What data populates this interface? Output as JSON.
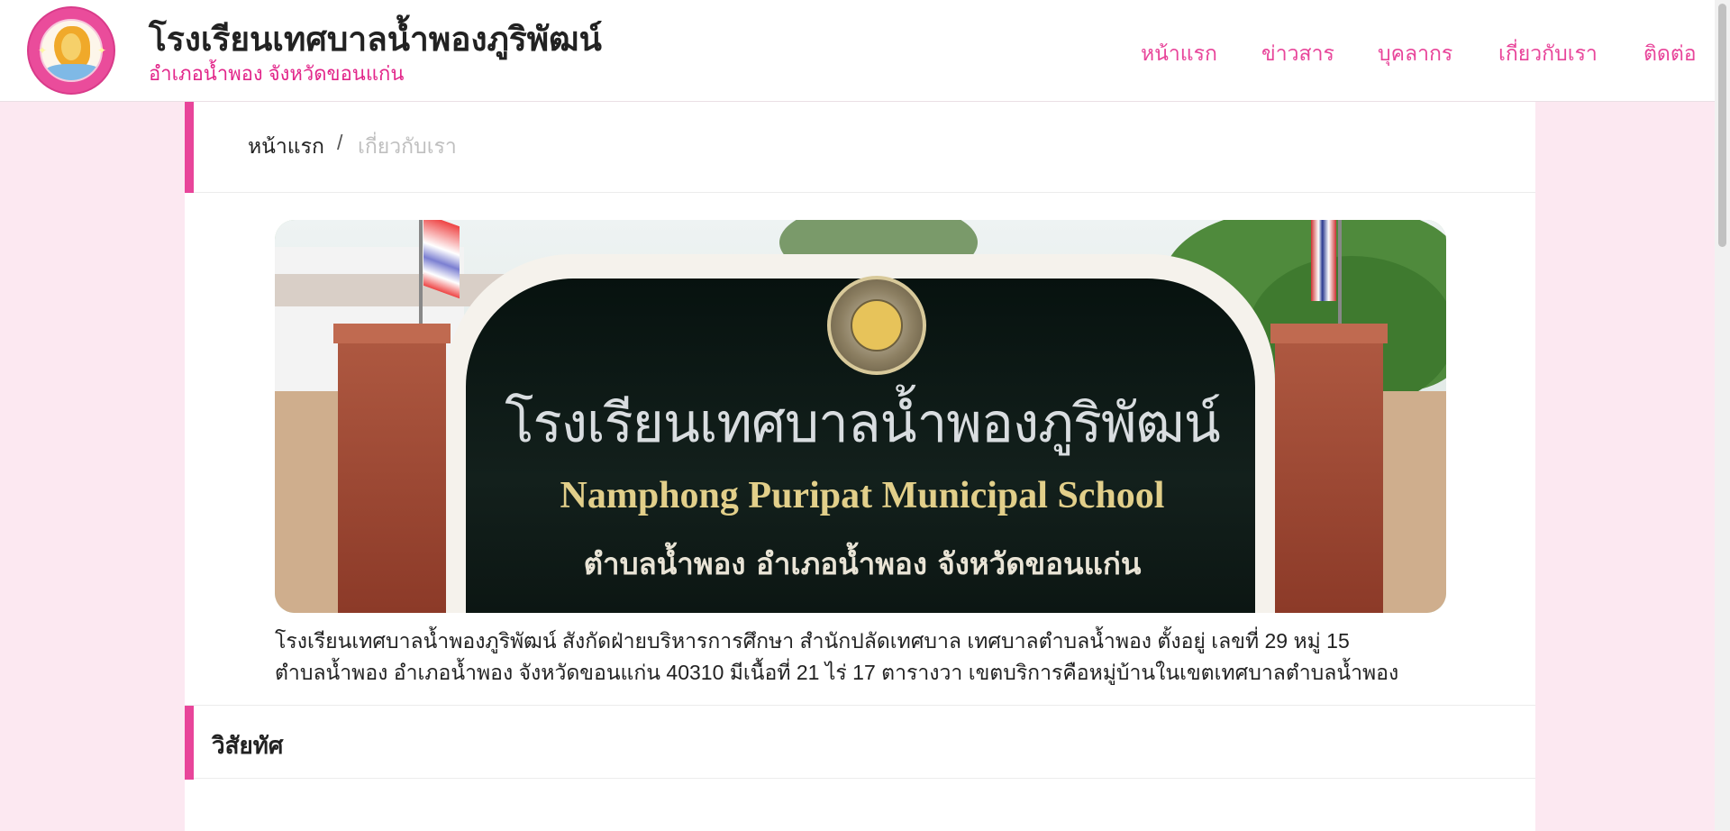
{
  "header": {
    "title": "โรงเรียนเทศบาลน้ำพองภูริพัฒน์",
    "subtitle": "อำเภอน้ำพอง จังหวัดขอนแก่น",
    "nav": [
      {
        "label": "หน้าแรก"
      },
      {
        "label": "ข่าวสาร"
      },
      {
        "label": "บุคลากร"
      },
      {
        "label": "เกี่ยวกับเรา"
      },
      {
        "label": "ติดต่อ"
      }
    ]
  },
  "breadcrumb": {
    "home": "หน้าแรก",
    "separator": "/",
    "current": "เกี่ยวกับเรา"
  },
  "photo": {
    "sign_thai": "โรงเรียนเทศบาลน้ำพองภูริพัฒน์",
    "sign_english": "Namphong Puripat Municipal School",
    "sign_address": "ตำบลน้ำพอง อำเภอน้ำพอง จังหวัดขอนแก่น"
  },
  "intro": {
    "line1": "โรงเรียนเทศบาลน้ำพองภูริพัฒน์ สังกัดฝ่ายบริหารการศึกษา สำนักปลัดเทศบาล เทศบาลตำบลน้ำพอง ตั้งอยู่ เลขที่ 29 หมู่ 15",
    "line2": "ตำบลน้ำพอง อำเภอน้ำพอง จังหวัดขอนแก่น 40310 มีเนื้อที่ 21 ไร่ 17 ตารางวา เขตบริการคือหมู่บ้านในเขตเทศบาลตำบลน้ำพอง"
  },
  "vision": {
    "heading": "วิสัยทัศ"
  },
  "colors": {
    "accent": "#e8459a",
    "page_background": "#fce8f1",
    "subtitle": "#e2268a"
  }
}
